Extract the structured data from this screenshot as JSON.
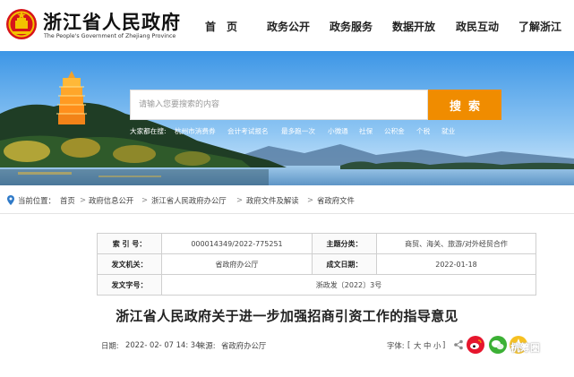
{
  "header": {
    "logo_cn": "浙江省人民政府",
    "logo_en": "The People's Government of Zhejiang Province",
    "nav": [
      "首　页",
      "政务公开",
      "政务服务",
      "数据开放",
      "政民互动",
      "了解浙江"
    ]
  },
  "search": {
    "placeholder": "请输入您要搜索的内容",
    "button": "搜索",
    "hot_label": "大家都在搜:",
    "hot_items": [
      "杭州市消费券",
      "会计考试报名",
      "最多跑一次",
      "小微通",
      "社保",
      "公积金",
      "个税",
      "就业"
    ]
  },
  "breadcrumb": {
    "label": "当前位置：",
    "items": [
      "首页",
      "政府信息公开",
      "浙江省人民政府办公厅",
      "政府文件及解读",
      "省政府文件"
    ],
    "separator": ">"
  },
  "info_table": {
    "index_label": "索 引 号：",
    "index_value": "000014349/2022-775251",
    "topic_label": "主题分类：",
    "topic_value": "商贸、海关、旅游/对外经贸合作",
    "issuer_label": "发文机关：",
    "issuer_value": "省政府办公厅",
    "date_label": "成文日期：",
    "date_value": "2022-01-18",
    "number_label": "发文字号：",
    "number_value": "浙政发〔2022〕3号"
  },
  "document": {
    "title": "浙江省人民政府关于进一步加强招商引资工作的指导意见"
  },
  "meta": {
    "date_label": "日期:",
    "date_value": "2022- 02- 07 14: 34",
    "source_label": "来源:",
    "source_value": "省政府办公厅",
    "font_label": "字体:",
    "font_open": "[",
    "font_large": "大",
    "font_medium": "中",
    "font_small": "小",
    "font_close": "]"
  },
  "watermark": "杭筹圈",
  "colors": {
    "accent_orange": "#f08c00",
    "emblem_red": "#d7141a",
    "emblem_gold": "#f3c200",
    "weibo_red": "#e6162d",
    "wechat_green": "#3cb035"
  },
  "icons": [
    "national-emblem-icon",
    "location-pin-icon",
    "share-icon",
    "weibo-icon",
    "wechat-icon",
    "qzone-icon"
  ]
}
